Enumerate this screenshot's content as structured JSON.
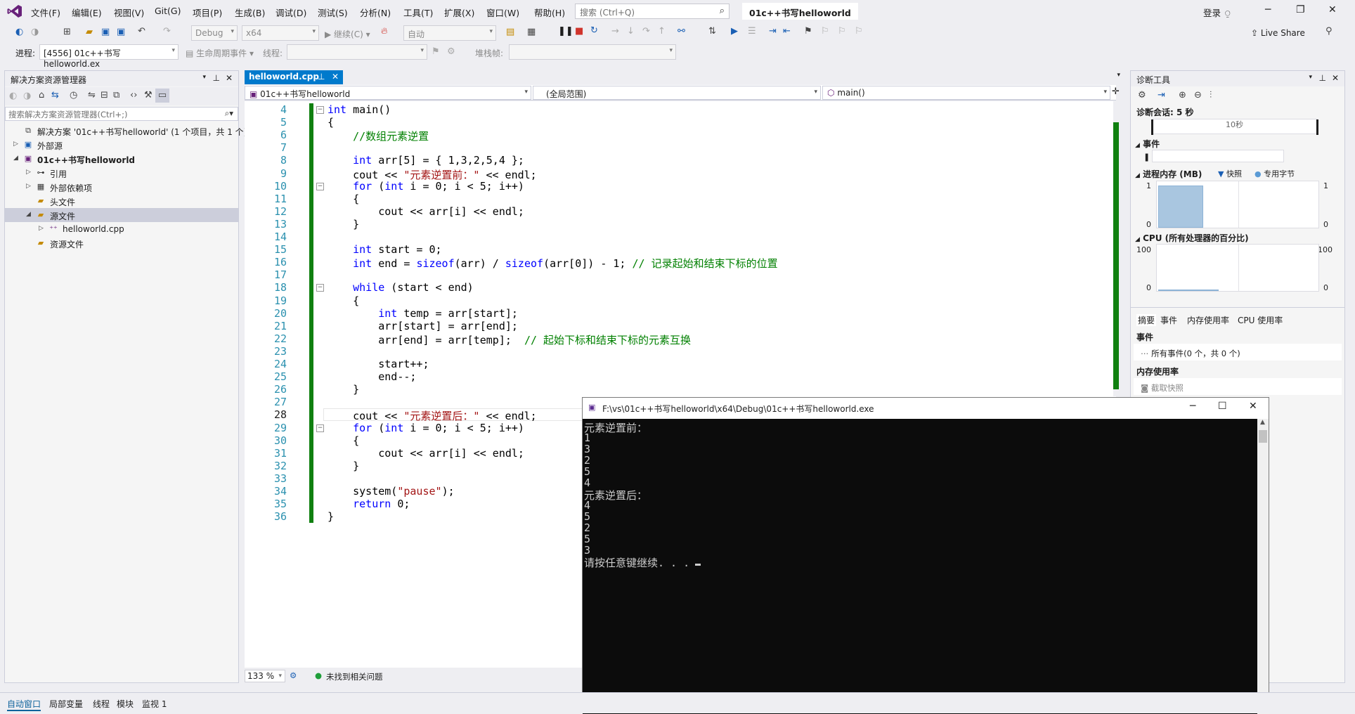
{
  "menu": {
    "items": [
      "文件(F)",
      "编辑(E)",
      "视图(V)",
      "Git(G)",
      "项目(P)",
      "生成(B)",
      "调试(D)",
      "测试(S)",
      "分析(N)",
      "工具(T)",
      "扩展(X)",
      "窗口(W)",
      "帮助(H)"
    ],
    "search_placeholder": "搜索 (Ctrl+Q)",
    "solution_name": "01c++书写helloworld",
    "login": "登录",
    "live_share": "Live Share"
  },
  "toolbar": {
    "config": "Debug",
    "platform": "x64",
    "continue_label": "继续(C)",
    "auto_label": "自动",
    "process_label": "进程:",
    "process_value": "[4556] 01c++书写helloworld.ex",
    "lifecycle_label": "生命周期事件",
    "thread_label": "线程:",
    "stackframe_label": "堆栈帧:"
  },
  "solution_explorer": {
    "title": "解决方案资源管理器",
    "search_placeholder": "搜索解决方案资源管理器(Ctrl+;)",
    "items": [
      {
        "label": "解决方案 '01c++书写helloworld' (1 个项目，共 1 个)",
        "indent": 0,
        "twisty": "",
        "icon": "solution-icon",
        "bold": false,
        "selected": false
      },
      {
        "label": "外部源",
        "indent": 0,
        "twisty": "▷",
        "icon": "external-icon",
        "bold": false,
        "selected": false
      },
      {
        "label": "01c++书写helloworld",
        "indent": 0,
        "twisty": "◢",
        "icon": "project-icon",
        "bold": true,
        "selected": false
      },
      {
        "label": "引用",
        "indent": 1,
        "twisty": "▷",
        "icon": "reference-icon",
        "bold": false,
        "selected": false
      },
      {
        "label": "外部依赖项",
        "indent": 1,
        "twisty": "▷",
        "icon": "dependency-icon",
        "bold": false,
        "selected": false
      },
      {
        "label": "头文件",
        "indent": 1,
        "twisty": "",
        "icon": "folder-icon",
        "bold": false,
        "selected": false
      },
      {
        "label": "源文件",
        "indent": 1,
        "twisty": "◢",
        "icon": "folder-icon",
        "bold": false,
        "selected": true
      },
      {
        "label": "helloworld.cpp",
        "indent": 2,
        "twisty": "▷",
        "icon": "cpp-file-icon",
        "bold": false,
        "selected": false
      },
      {
        "label": "资源文件",
        "indent": 1,
        "twisty": "",
        "icon": "folder-icon",
        "bold": false,
        "selected": false
      }
    ]
  },
  "editor": {
    "tab": "helloworld.cpp",
    "nav_project": "01c++书写helloworld",
    "nav_scope": "(全局范围)",
    "nav_member": "main()",
    "zoom": "133 %",
    "status": "未找到相关问题",
    "lines": [
      {
        "n": "4",
        "text": "int main()"
      },
      {
        "n": "5",
        "text": "{"
      },
      {
        "n": "6",
        "text": "    //数组元素逆置"
      },
      {
        "n": "7",
        "text": ""
      },
      {
        "n": "8",
        "text": "    int arr[5] = { 1,3,2,5,4 };"
      },
      {
        "n": "9",
        "text": "    cout << \"元素逆置前：\" << endl;"
      },
      {
        "n": "10",
        "text": "    for (int i = 0; i < 5; i++)"
      },
      {
        "n": "11",
        "text": "    {"
      },
      {
        "n": "12",
        "text": "        cout << arr[i] << endl;"
      },
      {
        "n": "13",
        "text": "    }"
      },
      {
        "n": "14",
        "text": ""
      },
      {
        "n": "15",
        "text": "    int start = 0;"
      },
      {
        "n": "16",
        "text": "    int end = sizeof(arr) / sizeof(arr[0]) - 1; // 记录起始和结束下标的位置"
      },
      {
        "n": "17",
        "text": ""
      },
      {
        "n": "18",
        "text": "    while (start < end)"
      },
      {
        "n": "19",
        "text": "    {"
      },
      {
        "n": "20",
        "text": "        int temp = arr[start];"
      },
      {
        "n": "21",
        "text": "        arr[start] = arr[end];"
      },
      {
        "n": "22",
        "text": "        arr[end] = arr[temp];  // 起始下标和结束下标的元素互换"
      },
      {
        "n": "23",
        "text": ""
      },
      {
        "n": "24",
        "text": "        start++;"
      },
      {
        "n": "25",
        "text": "        end--;"
      },
      {
        "n": "26",
        "text": "    }"
      },
      {
        "n": "27",
        "text": ""
      },
      {
        "n": "28",
        "text": "    cout << \"元素逆置后：\" << endl;"
      },
      {
        "n": "29",
        "text": "    for (int i = 0; i < 5; i++)"
      },
      {
        "n": "30",
        "text": "    {"
      },
      {
        "n": "31",
        "text": "        cout << arr[i] << endl;"
      },
      {
        "n": "32",
        "text": "    }"
      },
      {
        "n": "33",
        "text": ""
      },
      {
        "n": "34",
        "text": "    system(\"pause\");"
      },
      {
        "n": "35",
        "text": "    return 0;"
      },
      {
        "n": "36",
        "text": "}"
      }
    ]
  },
  "diagnostics": {
    "title": "诊断工具",
    "session": "诊断会话: 5 秒",
    "timeline_label": "10秒",
    "events_header": "事件",
    "memory_header": "进程内存 (MB)",
    "legend_snapshot": "快照",
    "legend_private": "专用字节",
    "mem_max": "1",
    "mem_min": "0",
    "cpu_header": "CPU (所有处理器的百分比)",
    "cpu_max": "100",
    "cpu_min": "0",
    "tabs": [
      "摘要",
      "事件",
      "内存使用率",
      "CPU 使用率"
    ],
    "events_section": "事件",
    "all_events": "所有事件(0 个，共 0 个)",
    "memory_section": "内存使用率",
    "take_snapshot": "截取快照"
  },
  "console": {
    "title": "F:\\vs\\01c++书写helloworld\\x64\\Debug\\01c++书写helloworld.exe",
    "lines": [
      "元素逆置前：",
      "1",
      "3",
      "2",
      "5",
      "4",
      "元素逆置后：",
      "4",
      "5",
      "2",
      "5",
      "3",
      "请按任意键继续. . . "
    ]
  },
  "bottom_tabs": [
    "自动窗口",
    "局部变量",
    "线程",
    "模块",
    "监视 1"
  ]
}
